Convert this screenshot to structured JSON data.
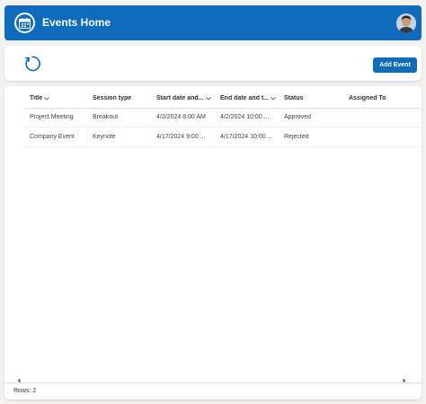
{
  "header": {
    "title": "Events Home",
    "app_icon": "calendar-icon",
    "accent": "#0f6cbd"
  },
  "toolbar": {
    "refresh_icon": "refresh-icon",
    "add_label": "Add Event"
  },
  "grid": {
    "columns": [
      {
        "label": "Title",
        "sortable": true
      },
      {
        "label": "Session type",
        "sortable": false
      },
      {
        "label": "Start date and...",
        "sortable": true
      },
      {
        "label": "End date and t...",
        "sortable": true
      },
      {
        "label": "Status",
        "sortable": false
      },
      {
        "label": "Assigned To",
        "sortable": false
      }
    ],
    "rows": [
      [
        "Project Meeting",
        "Breakout",
        "4/2/2024 8:00 AM",
        "4/2/2024 10:00 ...",
        "Approved",
        ""
      ],
      [
        "Company Event",
        "Keynote",
        "4/17/2024 9:00 ...",
        "4/17/2024 10:00 ...",
        "Rejected",
        ""
      ]
    ]
  },
  "footer": {
    "rows_label": "Rows: 2"
  }
}
